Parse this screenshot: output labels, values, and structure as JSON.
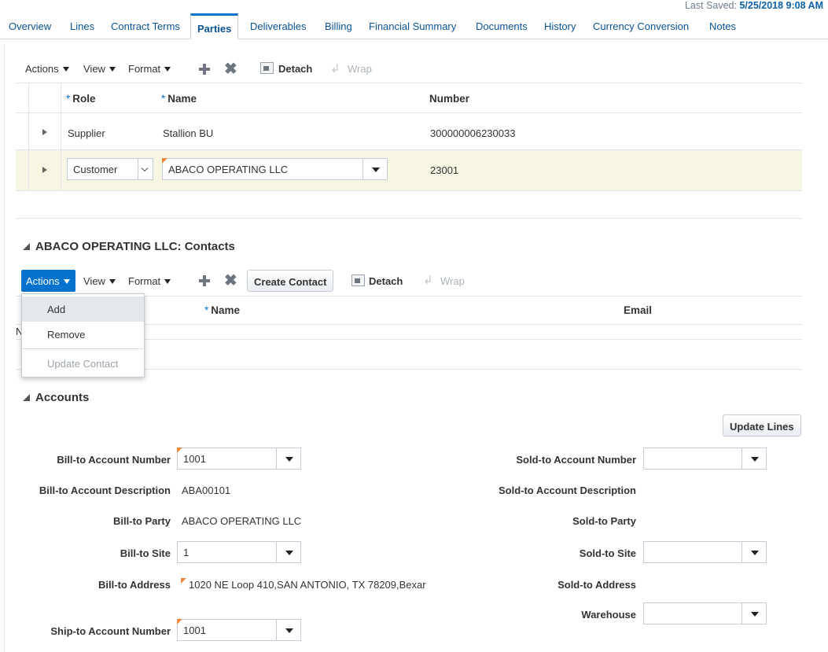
{
  "last_saved": {
    "label": "Last Saved:",
    "value": "5/25/2018 9:08 AM"
  },
  "tabs": [
    {
      "label": "Overview"
    },
    {
      "label": "Lines"
    },
    {
      "label": "Contract Terms"
    },
    {
      "label": "Parties"
    },
    {
      "label": "Deliverables"
    },
    {
      "label": "Billing"
    },
    {
      "label": "Financial Summary"
    },
    {
      "label": "Documents"
    },
    {
      "label": "History"
    },
    {
      "label": "Currency Conversion"
    },
    {
      "label": "Notes"
    }
  ],
  "parties_toolbar": {
    "actions": "Actions",
    "view": "View",
    "format": "Format",
    "detach": "Detach",
    "wrap": "Wrap"
  },
  "parties_table": {
    "required_marker": "*",
    "columns": {
      "role": "Role",
      "name": "Name",
      "number": "Number"
    },
    "rows": [
      {
        "role": "Supplier",
        "name": "Stallion BU",
        "number": "300000006230033"
      },
      {
        "role": "Customer",
        "name": "ABACO OPERATING LLC",
        "number": "23001"
      }
    ]
  },
  "contacts": {
    "title": "ABACO OPERATING LLC: Contacts",
    "toolbar": {
      "actions": "Actions",
      "view": "View",
      "format": "Format",
      "create_contact": "Create Contact",
      "detach": "Detach",
      "wrap": "Wrap"
    },
    "columns": {
      "name": "Name",
      "email": "Email"
    },
    "empty_text_partial": "N",
    "actions_menu": [
      {
        "label": "Add",
        "state": "hover"
      },
      {
        "label": "Remove",
        "state": "enabled"
      },
      {
        "label": "Update Contact",
        "state": "disabled"
      }
    ]
  },
  "accounts": {
    "title": "Accounts",
    "update_lines": "Update Lines",
    "left": [
      {
        "label": "Bill-to Account Number",
        "type": "select",
        "value": "1001"
      },
      {
        "label": "Bill-to Account Description",
        "type": "text",
        "value": "ABA00101"
      },
      {
        "label": "Bill-to Party",
        "type": "text",
        "value": "ABACO OPERATING LLC"
      },
      {
        "label": "Bill-to Site",
        "type": "select",
        "value": "1"
      },
      {
        "label": "Bill-to Address",
        "type": "text",
        "value": "1020 NE Loop 410,SAN ANTONIO, TX 78209,Bexar"
      },
      {
        "label": "Ship-to Account Number",
        "type": "select",
        "value": "1001"
      }
    ],
    "right": [
      {
        "label": "Sold-to Account Number",
        "type": "select",
        "value": ""
      },
      {
        "label": "Sold-to Account Description",
        "type": "text",
        "value": ""
      },
      {
        "label": "Sold-to Party",
        "type": "text",
        "value": ""
      },
      {
        "label": "Sold-to Site",
        "type": "select",
        "value": ""
      },
      {
        "label": "Sold-to Address",
        "type": "text",
        "value": ""
      },
      {
        "label": "Warehouse",
        "type": "select",
        "value": ""
      }
    ]
  },
  "colors": {
    "accent_blue": "#0572ce",
    "link_blue": "#0b5394",
    "selected_row": "#f6f6e3",
    "required_flag": "#f0883e"
  }
}
